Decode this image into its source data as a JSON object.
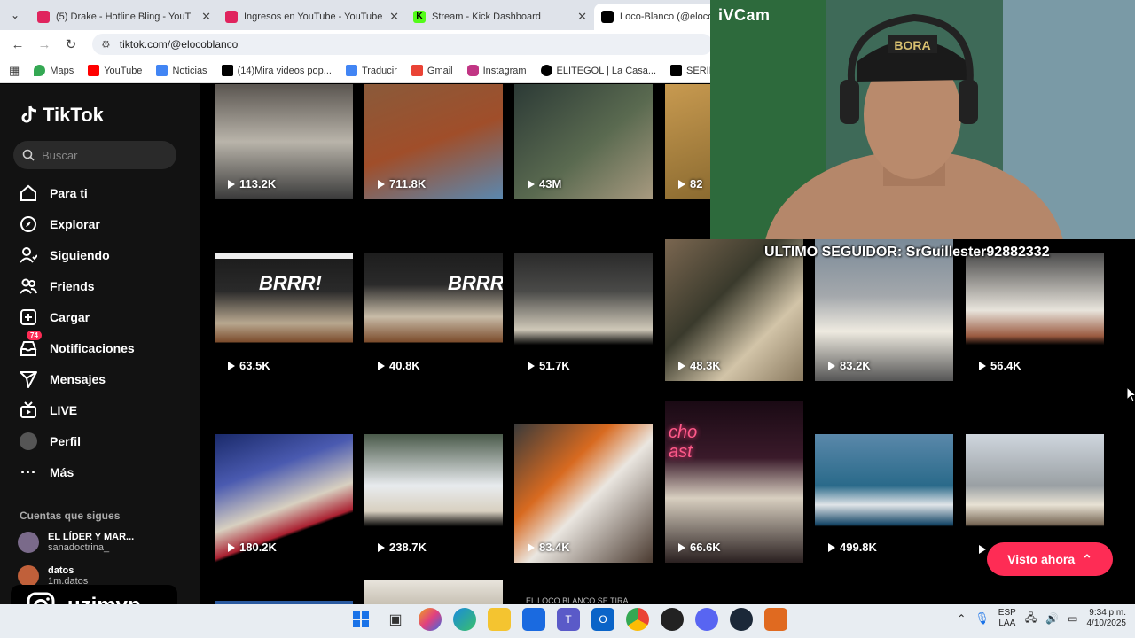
{
  "browser": {
    "tabs": [
      {
        "title": "(5) Drake - Hotline Bling - YouT",
        "color": "#e0245e"
      },
      {
        "title": "Ingresos en YouTube - YouTube",
        "color": "#e0245e"
      },
      {
        "title": "Stream - Kick Dashboard",
        "color": "#53fc18"
      },
      {
        "title": "Loco-Blanco (@eloco",
        "color": "#000000"
      }
    ],
    "url": "tiktok.com/@elocoblanco",
    "bookmarks": [
      {
        "label": "Maps",
        "color": "#34a853"
      },
      {
        "label": "YouTube",
        "color": "#ff0000"
      },
      {
        "label": "Noticias",
        "color": "#4285f4"
      },
      {
        "label": "(14)Mira videos pop...",
        "color": "#000000"
      },
      {
        "label": "Traducir",
        "color": "#4285f4"
      },
      {
        "label": "Gmail",
        "color": "#ea4335"
      },
      {
        "label": "Instagram",
        "color": "#c13584"
      },
      {
        "label": "ELITEGOL | La Casa...",
        "color": "#000000"
      },
      {
        "label": "SERIESK",
        "color": "#000000"
      }
    ]
  },
  "tiktok": {
    "logo": "TikTok",
    "search_placeholder": "Buscar",
    "nav": [
      {
        "label": "Para ti",
        "icon": "home-icon"
      },
      {
        "label": "Explorar",
        "icon": "compass-icon"
      },
      {
        "label": "Siguiendo",
        "icon": "following-icon"
      },
      {
        "label": "Friends",
        "icon": "friends-icon"
      },
      {
        "label": "Cargar",
        "icon": "upload-icon"
      },
      {
        "label": "Notificaciones",
        "icon": "inbox-icon",
        "badge": "74"
      },
      {
        "label": "Mensajes",
        "icon": "send-icon"
      },
      {
        "label": "LIVE",
        "icon": "live-icon"
      },
      {
        "label": "Perfil",
        "icon": "avatar-icon"
      },
      {
        "label": "Más",
        "icon": "more-icon"
      }
    ],
    "following_title": "Cuentas que sigues",
    "accounts": [
      {
        "name": "EL LÍDER Y MAR...",
        "handle": "sanadoctrina_"
      },
      {
        "name": "datos",
        "handle": "1m.datos"
      }
    ],
    "videos_row1": [
      "113.2K",
      "711.8K",
      "43M",
      "82"
    ],
    "videos_row2": [
      "63.5K",
      "40.8K",
      "51.7K",
      "48.3K",
      "83.2K",
      "56.4K"
    ],
    "videos_row3": [
      "180.2K",
      "238.7K",
      "83.4K",
      "66.6K",
      "499.8K",
      ""
    ],
    "seen_button": "Visto ahora",
    "bottom_caption": "EL LOCO BLANCO SE TIRA"
  },
  "stream": {
    "cam_label": "iVCam",
    "last_follower": "ULTIMO SEGUIDOR: SrGuillester92882332",
    "instagram_handle": "uzimvp"
  },
  "taskbar": {
    "lang_line1": "ESP",
    "lang_line2": "LAA",
    "time": "9:34 p.m.",
    "date": "4/10/2025"
  }
}
